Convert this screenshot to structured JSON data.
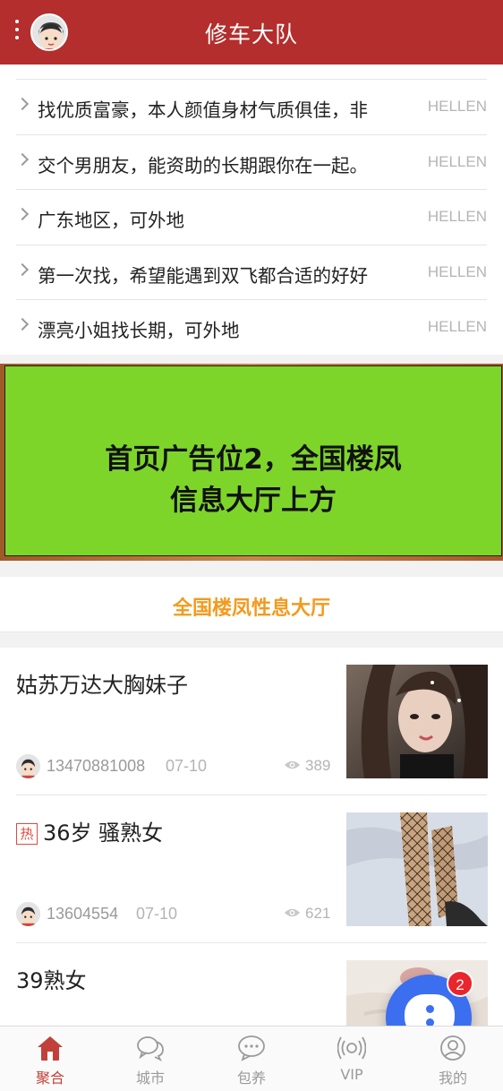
{
  "header": {
    "title": "修车大队"
  },
  "notices": [
    {
      "text": "找优质富豪，本人颜值身材气质俱佳，非",
      "author": "HELLEN"
    },
    {
      "text": "交个男朋友，能资助的长期跟你在一起。",
      "author": "HELLEN"
    },
    {
      "text": "广东地区，可外地",
      "author": "HELLEN"
    },
    {
      "text": "第一次找，希望能遇到双飞都合适的好好",
      "author": "HELLEN"
    },
    {
      "text": "漂亮小姐找长期，可外地",
      "author": "HELLEN"
    }
  ],
  "ad": {
    "line1": "首页广告位2，全国楼凤",
    "line2": "信息大厅上方"
  },
  "section": {
    "title": "全国楼凤性息大厅"
  },
  "posts": [
    {
      "title": "姑苏万达大胸妹子",
      "hot": false,
      "phone": "13470881008",
      "date": "07-10",
      "views": "389"
    },
    {
      "title": "36岁 骚熟女",
      "hot": true,
      "hot_label": "热",
      "phone": "13604554",
      "date": "07-10",
      "views": "621"
    },
    {
      "title": "39熟女",
      "hot": false
    }
  ],
  "fab": {
    "badge": "2"
  },
  "tabs": [
    {
      "label": "聚合",
      "icon": "home-icon",
      "active": true
    },
    {
      "label": "城市",
      "icon": "chat-bubbles-icon",
      "active": false
    },
    {
      "label": "包养",
      "icon": "message-icon",
      "active": false
    },
    {
      "label": "VIP",
      "icon": "broadcast-icon",
      "active": false
    },
    {
      "label": "我的",
      "icon": "user-icon",
      "active": false
    }
  ],
  "colors": {
    "header_bg": "#b32e2c",
    "ad_green": "#7ed52a",
    "section_title": "#f39a1e",
    "fab_blue": "#3b6ff0",
    "badge_red": "#e8262b",
    "tab_active": "#c1413a"
  }
}
